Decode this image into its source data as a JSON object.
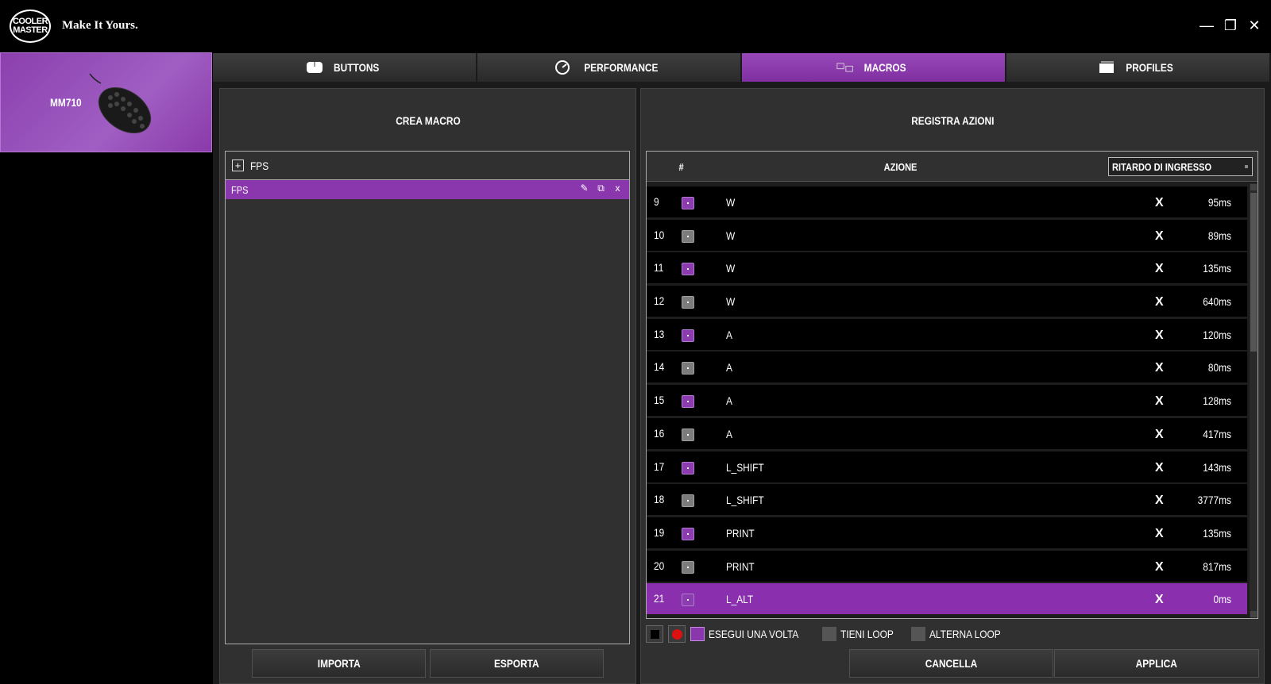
{
  "window": {
    "logo_text": "COOLER MASTER",
    "tagline": "Make It Yours.",
    "controls": [
      "minimize",
      "restore",
      "close"
    ]
  },
  "device": {
    "name": "MM710"
  },
  "tabs": [
    {
      "label": "BUTTONS",
      "icon": "mouse-buttons-icon",
      "active": false
    },
    {
      "label": "PERFORMANCE",
      "icon": "gauge-icon",
      "active": false
    },
    {
      "label": "MACROS",
      "icon": "macro-icon",
      "active": true
    },
    {
      "label": "PROFILES",
      "icon": "profiles-icon",
      "active": false
    }
  ],
  "create_macro": {
    "title": "CREA MACRO",
    "group_label": "FPS",
    "items": [
      {
        "label": "FPS",
        "selected": true
      }
    ],
    "import_label": "IMPORTA",
    "export_label": "ESPORTA"
  },
  "record_actions": {
    "title": "REGISTRA AZIONI",
    "col_num": "#",
    "col_action": "AZIONE",
    "delay_select": "RITARDO DI INGRESSO",
    "rows": [
      {
        "num": "9",
        "type": "down",
        "key": "W",
        "delay": "95ms"
      },
      {
        "num": "10",
        "type": "up",
        "key": "W",
        "delay": "89ms"
      },
      {
        "num": "11",
        "type": "down",
        "key": "W",
        "delay": "135ms"
      },
      {
        "num": "12",
        "type": "up",
        "key": "W",
        "delay": "640ms"
      },
      {
        "num": "13",
        "type": "down",
        "key": "A",
        "delay": "120ms"
      },
      {
        "num": "14",
        "type": "up",
        "key": "A",
        "delay": "80ms"
      },
      {
        "num": "15",
        "type": "down",
        "key": "A",
        "delay": "128ms"
      },
      {
        "num": "16",
        "type": "up",
        "key": "A",
        "delay": "417ms"
      },
      {
        "num": "17",
        "type": "down",
        "key": "L_SHIFT",
        "delay": "143ms"
      },
      {
        "num": "18",
        "type": "up",
        "key": "L_SHIFT",
        "delay": "3777ms"
      },
      {
        "num": "19",
        "type": "down",
        "key": "PRINT",
        "delay": "135ms"
      },
      {
        "num": "20",
        "type": "up",
        "key": "PRINT",
        "delay": "817ms"
      },
      {
        "num": "21",
        "type": "down",
        "key": "L_ALT",
        "delay": "0ms",
        "selected": true
      }
    ],
    "delete_symbol": "X",
    "options": {
      "run_once": "ESEGUI UNA VOLTA",
      "hold_loop": "TIENI LOOP",
      "toggle_loop": "ALTERNA LOOP",
      "selected": "run_once"
    },
    "cancel_label": "CANCELLA",
    "apply_label": "APPLICA"
  },
  "colors": {
    "accent": "#8a36ad",
    "background": "#000000",
    "panel": "#303030"
  }
}
